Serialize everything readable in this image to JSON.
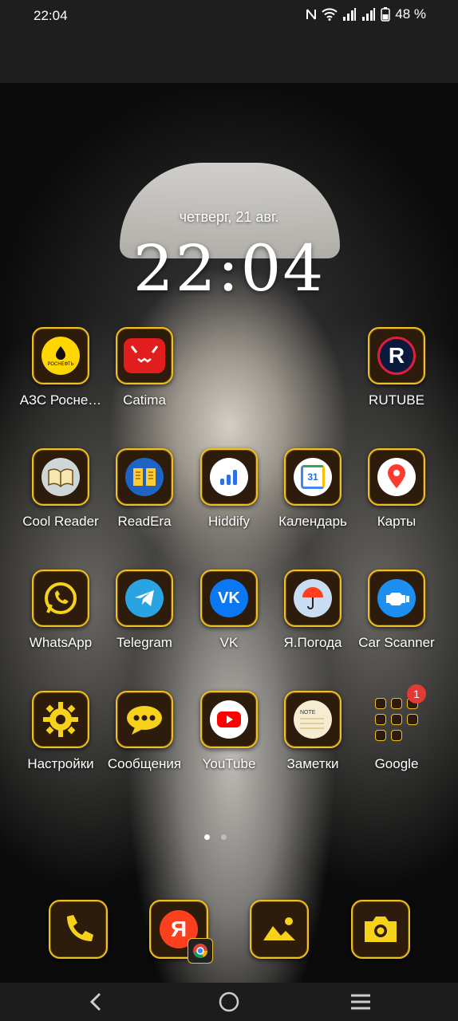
{
  "status_bar": {
    "time": "22:04",
    "battery": "48 %"
  },
  "lockscreen": {
    "date": "четверг, 21 авг.",
    "clock": "22:04"
  },
  "apps": [
    {
      "label": "АЗС Росне…",
      "icon": "rosneft-icon"
    },
    {
      "label": "Catima",
      "icon": "catima-icon"
    },
    {
      "label": "RUTUBE",
      "icon": "rutube-icon"
    },
    {
      "label": "Cool Reader",
      "icon": "cool-reader-icon"
    },
    {
      "label": "ReadEra",
      "icon": "readera-icon"
    },
    {
      "label": "Hiddify",
      "icon": "hiddify-icon"
    },
    {
      "label": "Календарь",
      "icon": "calendar-icon"
    },
    {
      "label": "Карты",
      "icon": "maps-icon"
    },
    {
      "label": "WhatsApp",
      "icon": "whatsapp-icon"
    },
    {
      "label": "Telegram",
      "icon": "telegram-icon"
    },
    {
      "label": "VK",
      "icon": "vk-icon"
    },
    {
      "label": "Я.Погода",
      "icon": "weather-icon"
    },
    {
      "label": "Car Scanner",
      "icon": "car-scanner-icon"
    },
    {
      "label": "Настройки",
      "icon": "settings-icon"
    },
    {
      "label": "Сообщения",
      "icon": "messages-icon"
    },
    {
      "label": "YouTube",
      "icon": "youtube-icon"
    },
    {
      "label": "Заметки",
      "icon": "notes-icon"
    }
  ],
  "folder": {
    "label": "Google",
    "badge": "1"
  },
  "icon_text": {
    "rosneft": "РОСНЕФТЬ",
    "rutube": "R",
    "calendar": "31",
    "vk": "VK",
    "note": "NOTE",
    "yandex": "Я"
  },
  "colors": {
    "tile_border": "#f0c020",
    "tile_bg": "#2d1c0c",
    "badge": "#e53935"
  },
  "dock": [
    {
      "icon": "phone-icon"
    },
    {
      "icon": "yandex-browser-icon"
    },
    {
      "icon": "gallery-icon"
    },
    {
      "icon": "camera-icon"
    }
  ],
  "nav_bar": {
    "icons": [
      "back-icon",
      "home-icon",
      "recents-icon"
    ]
  }
}
